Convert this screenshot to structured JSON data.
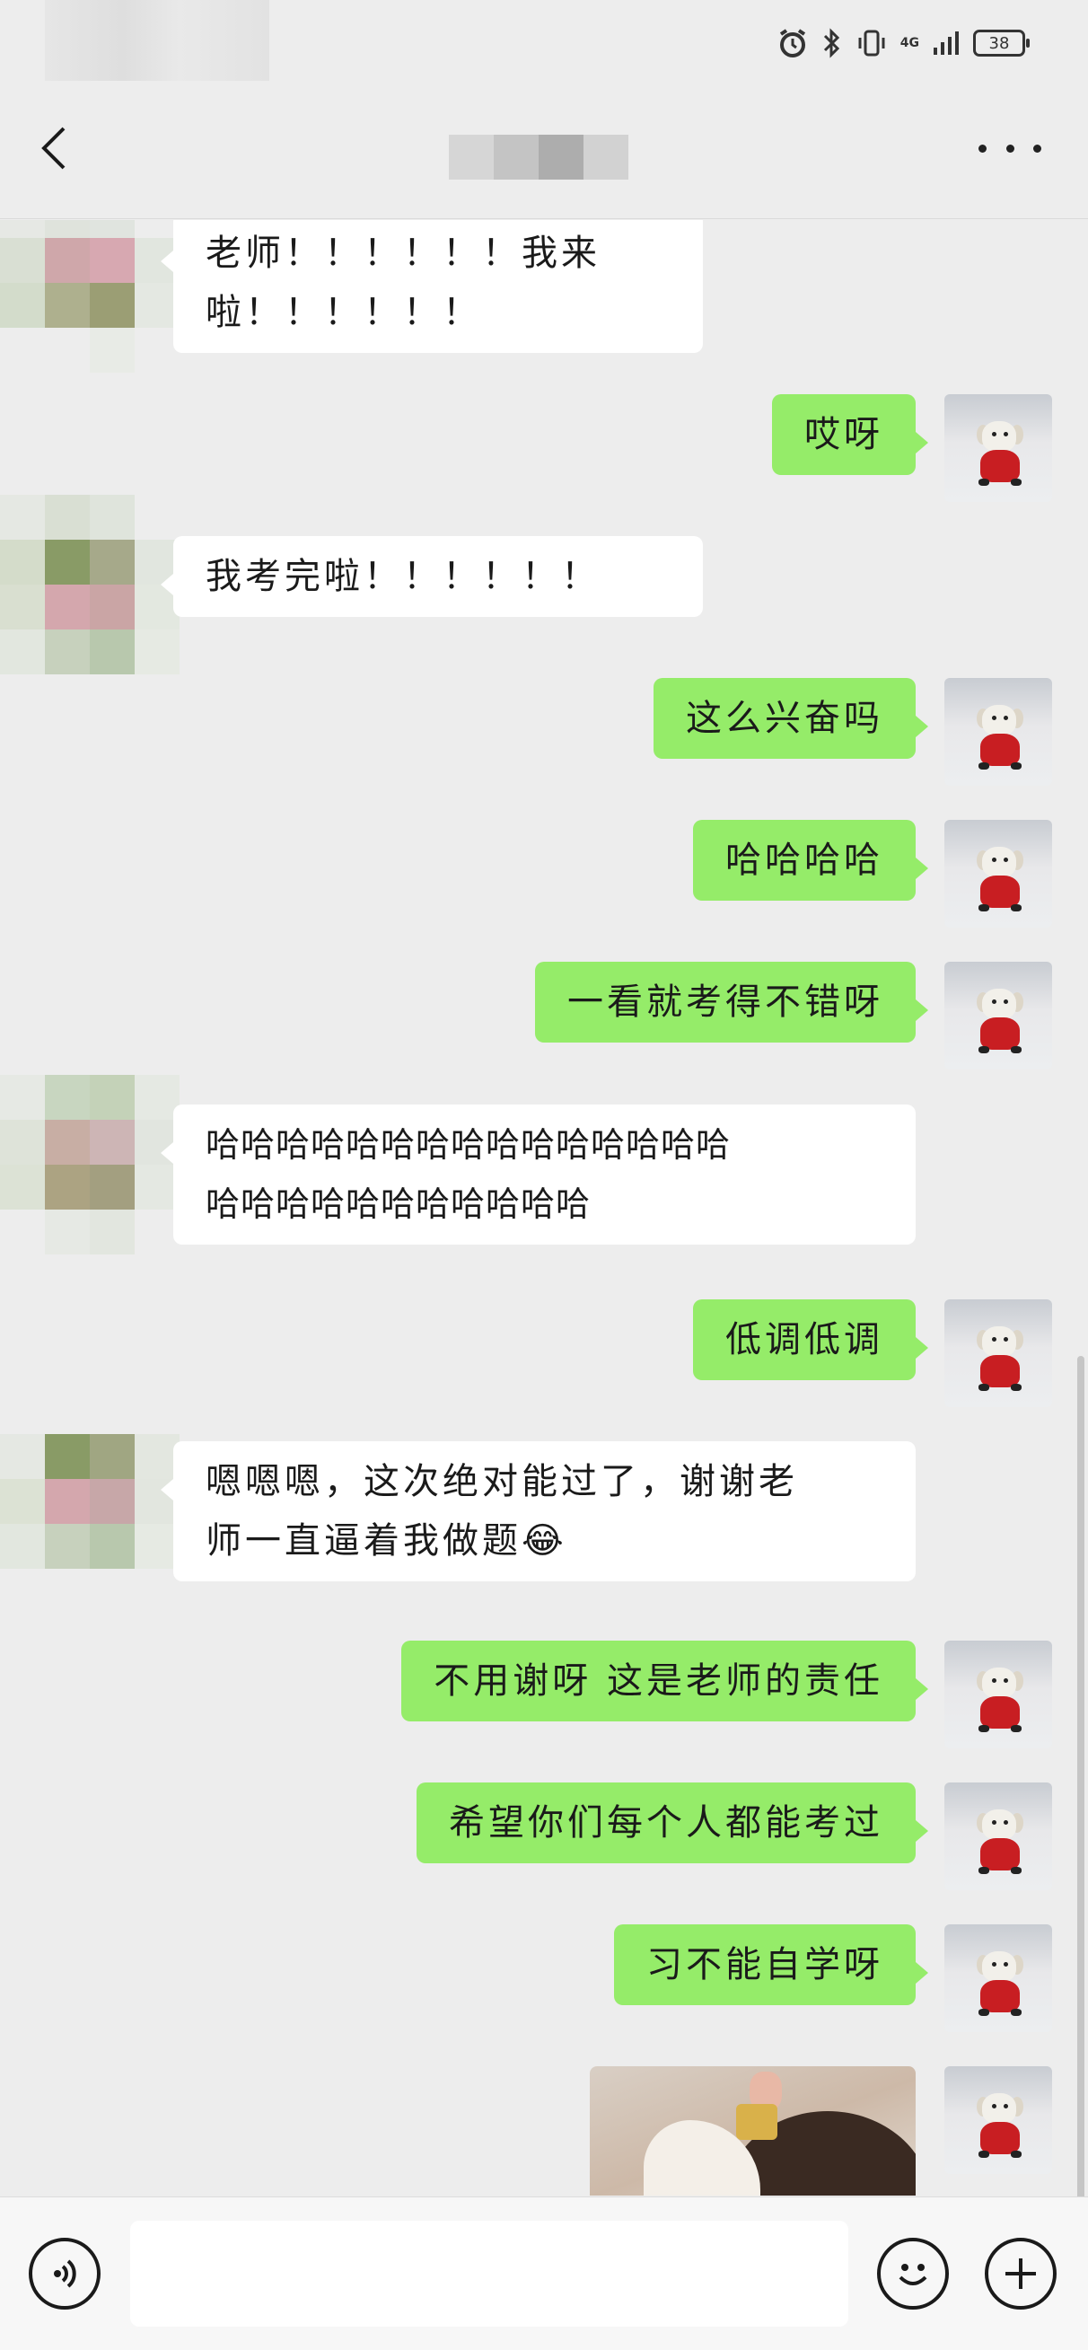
{
  "status_bar": {
    "battery": "38",
    "network": "4G",
    "icons": [
      "alarm-icon",
      "bluetooth-icon",
      "vibrate-icon",
      "signal-icon",
      "battery-icon"
    ]
  },
  "header": {
    "back_icon": "chevron-left-icon",
    "more_icon": "more-icon"
  },
  "messages": [
    {
      "side": "in",
      "text": "老师！！！！！！我来\n啦！！！！！！"
    },
    {
      "side": "out",
      "text": "哎呀"
    },
    {
      "side": "in",
      "text": "我考完啦！！！！！！"
    },
    {
      "side": "out",
      "text": "这么兴奋吗"
    },
    {
      "side": "out",
      "text": "哈哈哈哈"
    },
    {
      "side": "out",
      "text": "一看就考得不错呀"
    },
    {
      "side": "in",
      "text": "哈哈哈哈哈哈哈哈哈哈哈哈哈哈哈\n哈哈哈哈哈哈哈哈哈哈哈"
    },
    {
      "side": "out",
      "text": "低调低调"
    },
    {
      "side": "in",
      "text": "嗯嗯嗯，这次绝对能过了，谢谢老\n师一直逼着我做题😂"
    },
    {
      "side": "out",
      "text": "不用谢呀 这是老师的责任"
    },
    {
      "side": "out",
      "text": "希望你们每个人都能考过"
    },
    {
      "side": "out",
      "text": "习不能自学呀"
    },
    {
      "side": "out",
      "type": "image"
    }
  ],
  "input_bar": {
    "voice_icon": "voice-icon",
    "emoji_icon": "emoji-icon",
    "plus_icon": "plus-icon",
    "message_value": ""
  },
  "colors": {
    "background": "#ededed",
    "outgoing_bubble": "#95ec69",
    "incoming_bubble": "#ffffff",
    "input_bar": "#f7f7f7"
  }
}
